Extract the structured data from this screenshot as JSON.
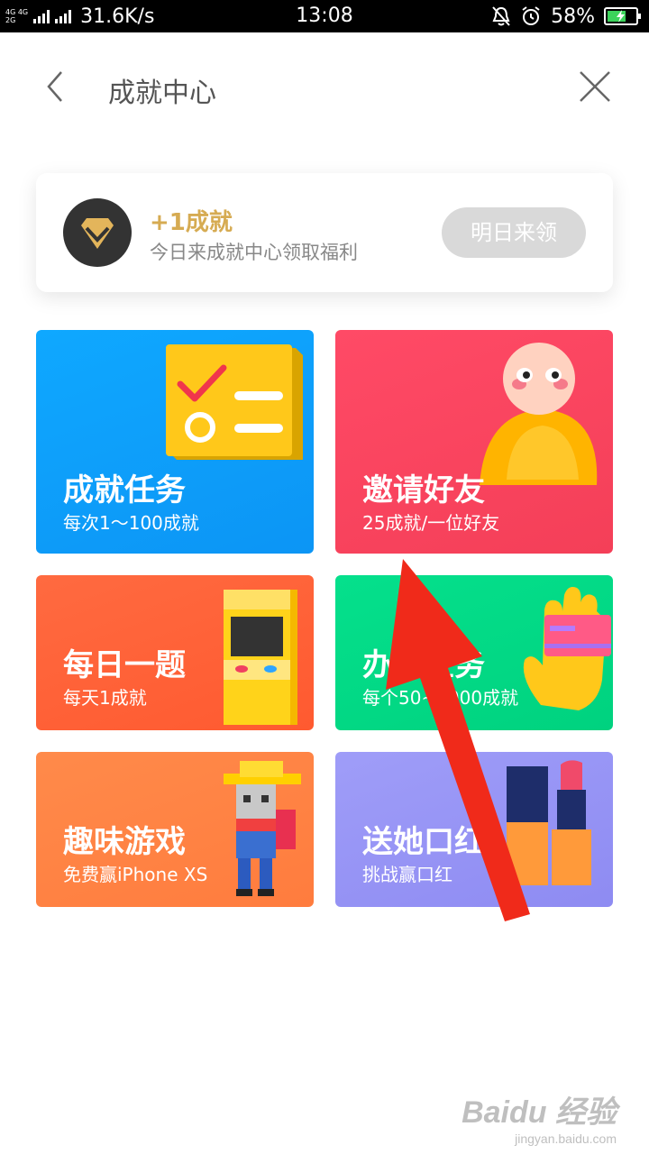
{
  "status_bar": {
    "network_top": "4G 4G",
    "network_bottom": "2G",
    "speed": "31.6K/s",
    "time": "13:08",
    "battery": "58%"
  },
  "header": {
    "title": "成就中心"
  },
  "reward": {
    "title": "+1成就",
    "subtitle": "今日来成就中心领取福利",
    "button": "明日来领"
  },
  "tiles": [
    {
      "title": "成就任务",
      "subtitle": "每次1～100成就",
      "color": "#0ea2fb"
    },
    {
      "title": "邀请好友",
      "subtitle": "25成就/一位好友",
      "color": "#fa455f"
    },
    {
      "title": "每日一题",
      "subtitle": "每天1成就",
      "color": "#ff6338"
    },
    {
      "title": "办卡任务",
      "subtitle": "每个50~1000成就",
      "color": "#03d986"
    },
    {
      "title": "趣味游戏",
      "subtitle": "免费赢iPhone XS",
      "color": "#ff8444"
    },
    {
      "title": "送她口红",
      "subtitle": "挑战赢口红",
      "color": "#9794f5"
    }
  ],
  "watermark": {
    "main": "Baidu 经验",
    "url": "jingyan.baidu.com"
  },
  "colors": {
    "accent_gold": "#d6ab52",
    "annotation_arrow": "#f02a1a"
  }
}
